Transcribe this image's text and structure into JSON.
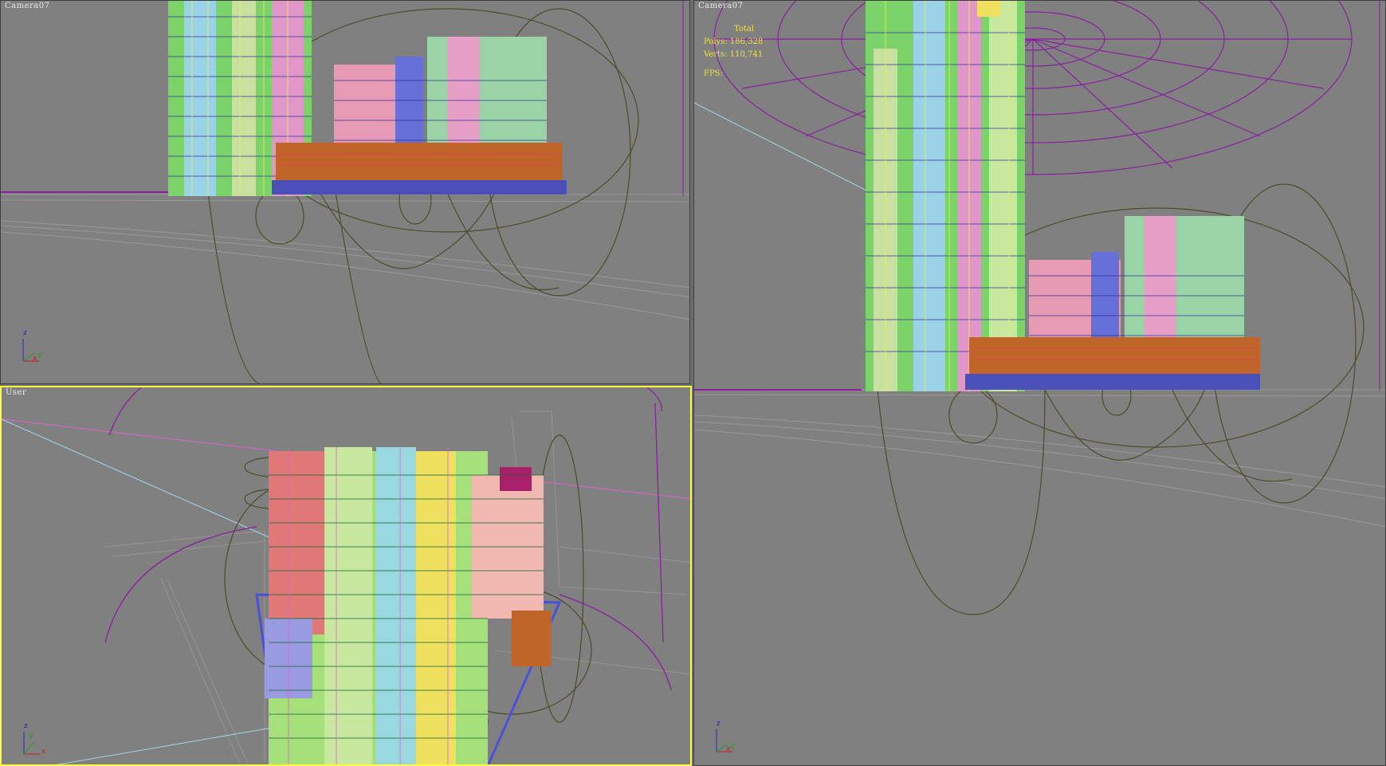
{
  "viewports": {
    "top_left": {
      "label": "Camera07",
      "active": false
    },
    "bottom_left": {
      "label": "User",
      "active": true
    },
    "right": {
      "label": "Camera07",
      "active": false
    }
  },
  "stats": {
    "total_label": "Total",
    "polys_label": "Polys:",
    "polys_value": "186,328",
    "verts_label": "Verts:",
    "verts_value": "110,741",
    "fps_label": "FPS:"
  },
  "axis": {
    "z": "z",
    "y": "y",
    "x": "x"
  },
  "colors": {
    "viewport_bg": "#808080",
    "active_border": "#ffff40",
    "stats_text": "#f2e23a",
    "wire_purple": "#8a1fa0",
    "wire_olive": "#4e4a2a",
    "brick": "#c0642a"
  }
}
